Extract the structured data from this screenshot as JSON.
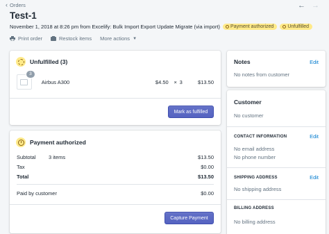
{
  "header": {
    "back_label": "Orders",
    "title": "Test-1",
    "meta": "November 1, 2018 at 8:26 pm from Excelify: Bulk Import Export Update Migrate (via import)",
    "badges": [
      "Payment authorized",
      "Unfulfilled"
    ],
    "actions": [
      "Print order",
      "Restock items",
      "More actions"
    ],
    "prev_icon": "arrow-left-icon",
    "next_icon": "arrow-right-icon"
  },
  "fulfillment": {
    "title": "Unfulfilled (3)",
    "item": {
      "quantity_badge": "3",
      "name": "Airbus A300",
      "price": "$4.50",
      "times": "×",
      "qty": "3",
      "total": "$13.50"
    },
    "button": "Mark as fulfilled"
  },
  "payment": {
    "title": "Payment authorized",
    "rows": [
      {
        "label": "Subtotal",
        "sub": "3 items",
        "amount": "$13.50"
      },
      {
        "label": "Tax",
        "sub": "",
        "amount": "$0.00"
      },
      {
        "label": "Total",
        "sub": "",
        "amount": "$13.50"
      },
      {
        "label": "Paid by customer",
        "sub": "",
        "amount": "$0.00"
      }
    ],
    "button": "Capture Payment"
  },
  "notes": {
    "title": "Notes",
    "edit": "Edit",
    "empty": "No notes from customer"
  },
  "customer": {
    "title": "Customer",
    "empty": "No customer",
    "contact_title": "CONTACT INFORMATION",
    "contact_edit": "Edit",
    "no_email": "No email address",
    "no_phone": "No phone number",
    "shipping_title": "SHIPPING ADDRESS",
    "shipping_edit": "Edit",
    "no_shipping": "No shipping address",
    "billing_title": "BILLING ADDRESS",
    "no_billing": "No billing address"
  },
  "colors": {
    "accent": "#5c6ac4",
    "link": "#007ace",
    "attention": "#ffea8a"
  }
}
